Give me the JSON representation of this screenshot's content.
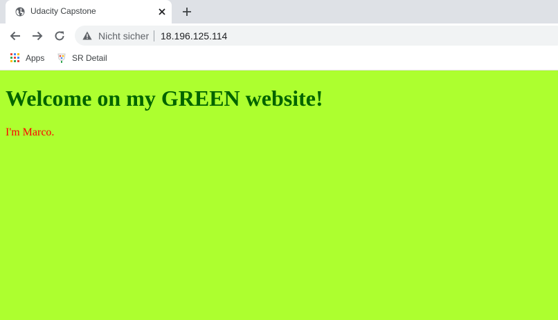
{
  "browser": {
    "tab": {
      "title": "Udacity Capstone",
      "close_icon": "close-icon",
      "favicon": "globe-icon"
    },
    "new_tab_icon": "plus-icon",
    "nav": {
      "back_icon": "arrow-left-icon",
      "forward_icon": "arrow-right-icon",
      "reload_icon": "reload-icon"
    },
    "address_bar": {
      "security_label": "Nicht sicher",
      "url": "18.196.125.114",
      "security_icon": "warning-icon"
    },
    "bookmarks": [
      {
        "label": "Apps",
        "icon": "apps-grid-icon"
      },
      {
        "label": "SR Detail",
        "icon": "sr-detail-icon"
      }
    ]
  },
  "page": {
    "heading": "Welcome on my GREEN website!",
    "text": "I'm Marco.",
    "colors": {
      "background": "#adff2f",
      "heading": "#006400",
      "text": "#ff0000"
    }
  }
}
